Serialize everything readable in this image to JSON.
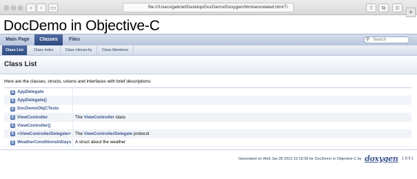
{
  "browser": {
    "url": "file:///Users/gabriel/Desktop/DocDemo/Doxygen/html/annotated.html",
    "back_glyph": "‹",
    "forward_glyph": "›",
    "reload_glyph": "↻",
    "share_glyph": "⇧",
    "tabs_glyph": "⧉",
    "download_glyph": "⊙",
    "new_tab_glyph": "+"
  },
  "project": {
    "title": "DocDemo in Objective-C"
  },
  "tabs": [
    {
      "label": "Main Page",
      "active": false
    },
    {
      "label": "Classes",
      "active": true
    },
    {
      "label": "Files",
      "active": false
    }
  ],
  "search": {
    "placeholder": "Search",
    "icon": "magnifier-icon"
  },
  "subtabs": [
    {
      "label": "Class List",
      "active": true
    },
    {
      "label": "Class Index",
      "active": false
    },
    {
      "label": "Class Hierarchy",
      "active": false
    },
    {
      "label": "Class Members",
      "active": false
    }
  ],
  "page": {
    "title": "Class List",
    "intro": "Here are the classes, structs, unions and interfaces with brief descriptions:"
  },
  "class_icon_letter": "C",
  "classes": [
    {
      "name": "AppDelegate",
      "desc_pre": "",
      "desc_link": "",
      "desc_post": ""
    },
    {
      "name": "AppDelegate()",
      "desc_pre": "",
      "desc_link": "",
      "desc_post": ""
    },
    {
      "name": "DocDemoObjCTests",
      "desc_pre": "",
      "desc_link": "",
      "desc_post": ""
    },
    {
      "name": "ViewController",
      "desc_pre": "The ",
      "desc_link": "ViewController",
      "desc_post": " class"
    },
    {
      "name": "ViewController()",
      "desc_pre": "",
      "desc_link": "",
      "desc_post": ""
    },
    {
      "name": "<ViewControllerDelegate>",
      "desc_pre": "The ",
      "desc_link": "ViewControllerDelegate",
      "desc_post": " protocol"
    },
    {
      "name": "WeatherConditionsInDays",
      "desc_pre": "A struct about the weather",
      "desc_link": "",
      "desc_post": ""
    }
  ],
  "footer": {
    "generated": "Generated on Wed Jan 28 2015 22:18:39 for DocDemo in Objective-C by",
    "logo": "doxygen",
    "version": "1.8.9.1"
  },
  "colors": {
    "accent": "#3d578c",
    "tab_active": "#2f4a80",
    "nav_bg": "#b8c6dd"
  }
}
